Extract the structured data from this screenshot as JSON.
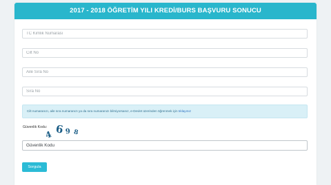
{
  "header": {
    "title": "2017 - 2018 ÖĞRETİM YILI KREDİ/BURS BAŞVURU SONUCU"
  },
  "form": {
    "tc_placeholder": "TC Kimlik Numarası",
    "cilt_placeholder": "Cilt No",
    "aile_placeholder": "Aile Sıra No",
    "sira_placeholder": "Sıra No"
  },
  "info": {
    "text": "Cilt numaranızı, aile sıra numaranızı ya da sıra numaranızı bilmiyorsanız, e-Devlet üzerinden öğrenmek için ",
    "link": "tıklayınız"
  },
  "captcha": {
    "label": "Güvenlik Kodu:",
    "digits": [
      "4",
      "6",
      "9",
      "8"
    ],
    "input_placeholder": "Güvenlik Kodu"
  },
  "submit": {
    "label": "Sorgula"
  },
  "colors": {
    "header": "#29b6cc",
    "button": "#2bbbd6",
    "info_bg": "#d9f0f7",
    "link": "#2a6fc2"
  }
}
